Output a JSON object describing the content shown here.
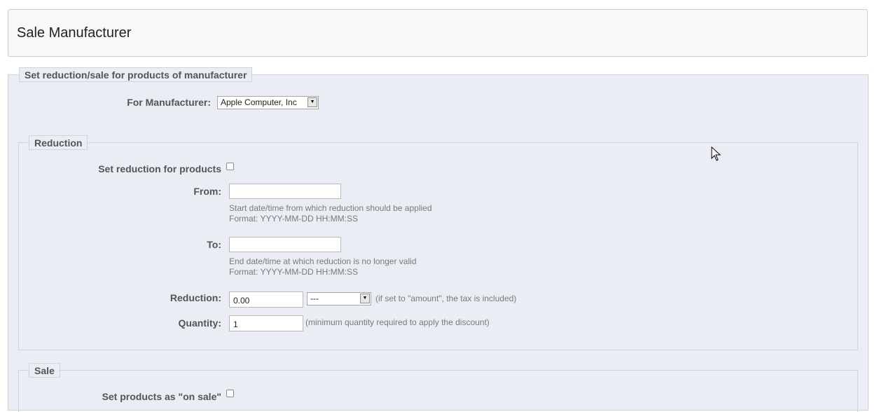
{
  "header": {
    "title": "Sale Manufacturer"
  },
  "panel": {
    "legend": "Set reduction/sale for products of manufacturer",
    "manufacturer_label": "For Manufacturer:",
    "manufacturer_selected": "Apple Computer, Inc"
  },
  "reduction": {
    "legend": "Reduction",
    "set_label": "Set reduction for products",
    "from_label": "From:",
    "from_value": "",
    "from_help_1": "Start date/time from which reduction should be applied",
    "from_help_2": "Format: YYYY-MM-DD HH:MM:SS",
    "to_label": "To:",
    "to_value": "",
    "to_help_1": "End date/time at which reduction is no longer valid",
    "to_help_2": "Format: YYYY-MM-DD HH:MM:SS",
    "reduction_label": "Reduction:",
    "reduction_value": "0.00",
    "reduction_type": "---",
    "reduction_help": "(if set to \"amount\", the tax is included)",
    "quantity_label": "Quantity:",
    "quantity_value": "1",
    "quantity_help": "(minimum quantity required to apply the discount)"
  },
  "sale": {
    "legend": "Sale",
    "set_label": "Set products as \"on sale\""
  }
}
